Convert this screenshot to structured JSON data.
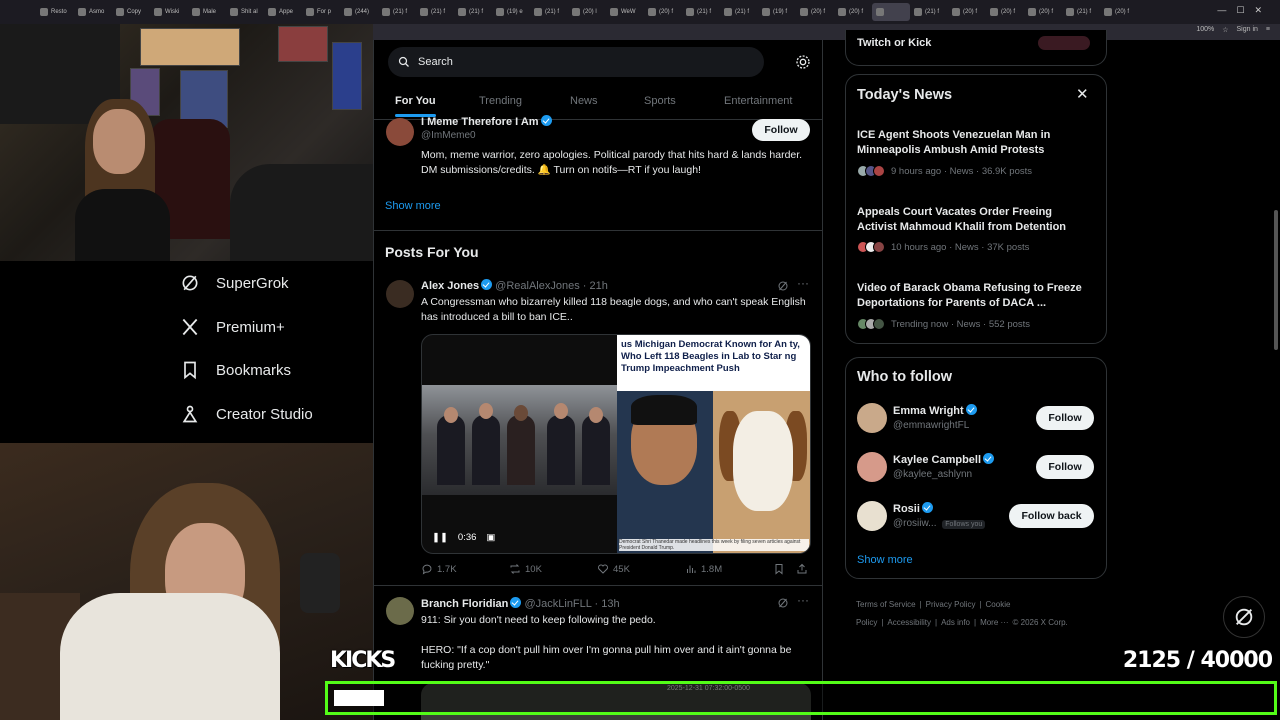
{
  "browser": {
    "tabs": [
      "Resto",
      "Asmo",
      "Copy",
      "Wiski",
      "Male",
      "Shit al",
      "Appe",
      "For p",
      "(244)",
      "(21) f",
      "(21) f",
      "(21) f",
      "(19) e",
      "(21) f",
      "(20) l",
      "WeW",
      "(20) f",
      "(21) f",
      "(21) f",
      "(19) f",
      "(20) f",
      "(20) f",
      "",
      "(21) f",
      "(20) f",
      "(20) f",
      "(20) f",
      "(21) f",
      "(20) f"
    ],
    "active_tab_index": 22,
    "zoom": "100%",
    "sign_in": "Sign in"
  },
  "left_nav": {
    "items": [
      {
        "label": "SuperGrok",
        "icon": "grok-icon"
      },
      {
        "label": "Premium+",
        "icon": "x-logo-icon"
      },
      {
        "label": "Bookmarks",
        "icon": "bookmark-icon"
      },
      {
        "label": "Creator Studio",
        "icon": "creator-studio-icon"
      }
    ]
  },
  "search": {
    "placeholder": "Search"
  },
  "feed_tabs": [
    "For You",
    "Trending",
    "News",
    "Sports",
    "Entertainment"
  ],
  "follow_card": {
    "name": "I Meme Therefore I Am",
    "handle": "@ImMeme0",
    "bio": "Mom, meme warrior, zero apologies. Political parody that hits hard & lands harder. DM submissions/credits. 🔔 Turn on notifs—RT if you laugh!",
    "follow_label": "Follow",
    "show_more": "Show more"
  },
  "posts_header": "Posts For You",
  "post1": {
    "name": "Alex Jones",
    "handle": "@RealAlexJones",
    "time": "· 21h",
    "text": "A Congressman who bizarrely killed 118 beagle dogs, and who can't speak English has introduced a bill to ban ICE..",
    "video_headline": "us Michigan Democrat Known for An ty, Who Left 118 Beagles in Lab to Star ng Trump Impeachment Push",
    "video_caption": "Democrat Shri Thanedar made headlines this week by filing seven articles against President Donald Trump.",
    "video_time": "0:36",
    "replies": "1.7K",
    "reposts": "10K",
    "likes": "45K",
    "views": "1.8M"
  },
  "post2": {
    "name": "Branch Floridian",
    "handle": "@JackLinFLL",
    "time": "· 13h",
    "line1": "911: Sir you don't need to keep following the pedo.",
    "line2": "HERO: \"If a cop don't pull him over I'm gonna pull him over and it ain't gonna be fucking pretty.\"",
    "media_stamp": "2025-12-31 07:32:00-0500"
  },
  "top_box": {
    "text": "Twitch or Kick"
  },
  "news": {
    "title": "Today's News",
    "items": [
      {
        "title": "ICE Agent Shoots Venezuelan Man in Minneapolis Ambush Amid Protests",
        "meta": "9 hours ago · News · 36.9K posts"
      },
      {
        "title": "Appeals Court Vacates Order Freeing Activist Mahmoud Khalil from Detention",
        "meta": "10 hours ago · News · 37K posts"
      },
      {
        "title": "Video of Barack Obama Refusing to Freeze Deportations for Parents of DACA ...",
        "meta": "Trending now · News · 552 posts"
      }
    ]
  },
  "who_to_follow": {
    "title": "Who to follow",
    "users": [
      {
        "name": "Emma Wright",
        "handle": "@emmawrightFL",
        "button": "Follow",
        "follows_you": ""
      },
      {
        "name": "Kaylee Campbell",
        "handle": "@kaylee_ashlynn",
        "button": "Follow",
        "follows_you": ""
      },
      {
        "name": "Rosii",
        "handle": "@rosiiw...",
        "button": "Follow back",
        "follows_you": "Follows you"
      }
    ],
    "show_more": "Show more"
  },
  "footer": {
    "links": [
      "Terms of Service",
      "|",
      "Privacy Policy",
      "|",
      "Cookie Policy",
      "|",
      "Accessibility",
      "|",
      "Ads info",
      "|",
      "More ···",
      "© 2026 X Corp."
    ]
  },
  "overlay": {
    "kicks_label": "KICKS",
    "counter": "2125   / 40000",
    "progress_fraction": 0.053
  },
  "colors": {
    "accent": "#1d9bf0",
    "kick_green": "#53fc18",
    "bg": "#000000"
  }
}
